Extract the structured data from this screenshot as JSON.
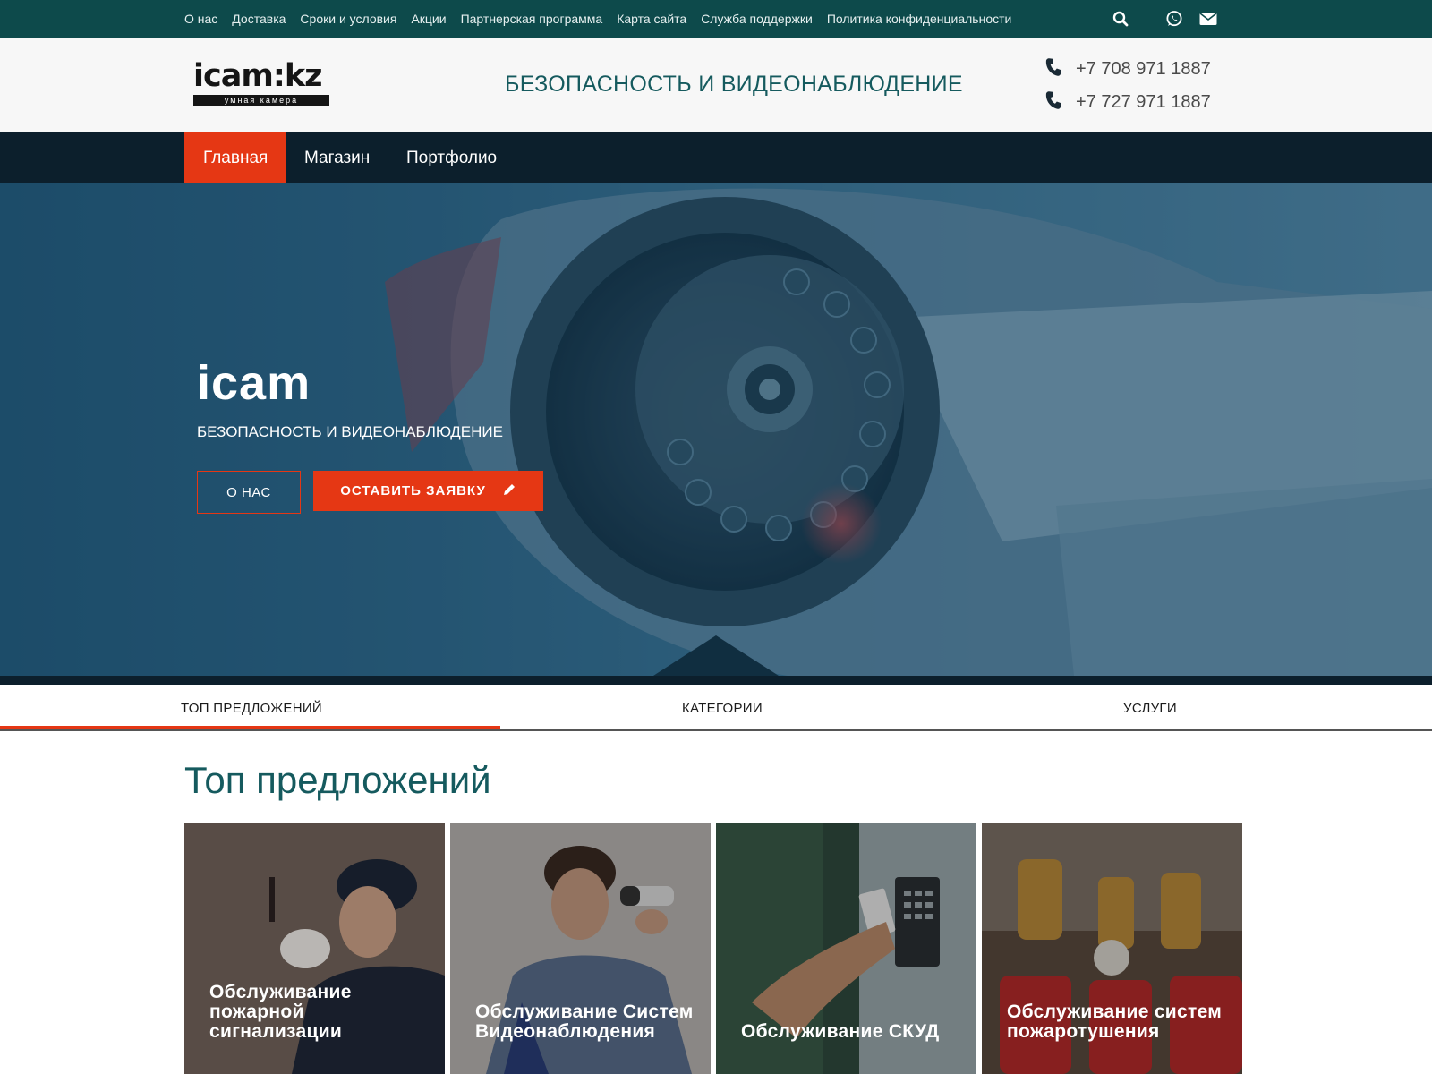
{
  "topbar": {
    "links": [
      "О нас",
      "Доставка",
      "Сроки и условия",
      "Акции",
      "Партнерская программа",
      "Карта сайта",
      "Служба поддержки",
      "Политика конфиденциальности"
    ],
    "icons": [
      "search-icon",
      "whatsapp-icon",
      "email-icon"
    ]
  },
  "header": {
    "logo_text": "icam:kz",
    "logo_tagline": "умная камера",
    "title": "БЕЗОПАСНОСТЬ И ВИДЕОНАБЛЮДЕНИЕ",
    "phones": [
      "+7 708 971 1887",
      "+7 727 971 1887"
    ]
  },
  "nav": {
    "items": [
      {
        "label": "Главная",
        "active": true
      },
      {
        "label": "Магазин",
        "active": false
      },
      {
        "label": "Портфолио",
        "active": false
      }
    ]
  },
  "hero": {
    "title": "icam",
    "subtitle": "БЕЗОПАСНОСТЬ И ВИДЕОНАБЛЮДЕНИЕ",
    "btn_about": "О НАС",
    "btn_request": "ОСТАВИТЬ ЗАЯВКУ"
  },
  "tabs": {
    "items": [
      "ТОП ПРЕДЛОЖЕНИЙ",
      "КАТЕГОРИИ",
      "УСЛУГИ"
    ],
    "active_index": 0
  },
  "section": {
    "title": "Топ предложений"
  },
  "cards": [
    {
      "label": "Обслуживание пожарной сигнализации"
    },
    {
      "label": "Обслуживание Систем Видеонаблюдения"
    },
    {
      "label": "Обслуживание СКУД"
    },
    {
      "label": "Обслуживание систем пожаротушения"
    }
  ],
  "colors": {
    "topbar": "#0d4a4b",
    "nav": "#0c1f2c",
    "accent": "#e53714",
    "title_teal": "#155a5e"
  }
}
